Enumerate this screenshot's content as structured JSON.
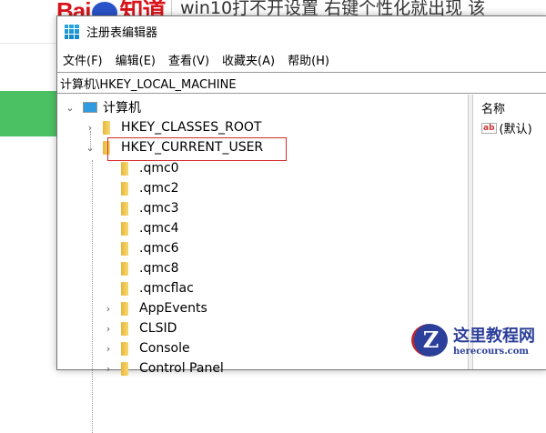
{
  "background": {
    "logo": "Bai知道",
    "question_title": "win10打不开设置 右键个性化就出现 该"
  },
  "window": {
    "title": "注册表编辑器",
    "menu": [
      "文件(F)",
      "编辑(E)",
      "查看(V)",
      "收藏夹(A)",
      "帮助(H)"
    ],
    "address": "计算机\\HKEY_LOCAL_MACHINE",
    "tree": {
      "root": "计算机",
      "hives": [
        "HKEY_CLASSES_ROOT",
        "HKEY_CURRENT_USER"
      ],
      "children": [
        ".qmc0",
        ".qmc2",
        ".qmc3",
        ".qmc4",
        ".qmc6",
        ".qmc8",
        ".qmcflac",
        "AppEvents",
        "CLSID",
        "Console",
        "Control Panel"
      ]
    },
    "values_pane": {
      "column_name": "名称",
      "default_value": "(默认)"
    }
  },
  "watermark": {
    "cn": "这里教程网",
    "en": "herecours.com"
  }
}
